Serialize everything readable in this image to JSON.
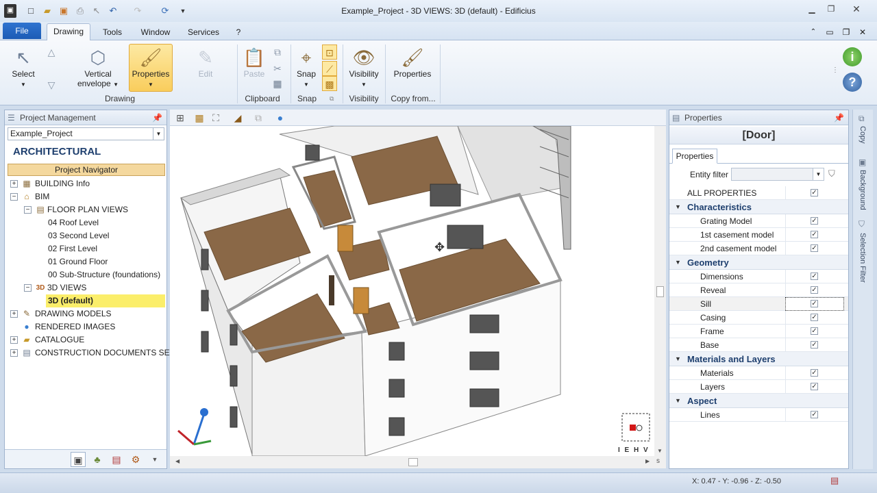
{
  "window": {
    "title": "Example_Project - 3D VIEWS: 3D (default) - Edificius"
  },
  "menu": {
    "file": "File",
    "tabs": [
      "Drawing",
      "Tools",
      "Window",
      "Services",
      "?"
    ]
  },
  "ribbon": {
    "select": "Select",
    "vertical": "Vertical",
    "envelope": "envelope",
    "properties": "Properties",
    "edit": "Edit",
    "drawing_group": "Drawing",
    "paste": "Paste",
    "clipboard_group": "Clipboard",
    "snap": "Snap",
    "snap_group": "Snap",
    "visibility": "Visibility",
    "visibility_group": "Visibility",
    "properties2": "Properties",
    "copy_group": "Copy from..."
  },
  "left": {
    "header": "Project Management",
    "project": "Example_Project",
    "section": "ARCHITECTURAL",
    "navigator": "Project Navigator",
    "tree": [
      "BUILDING Info",
      "BIM",
      "FLOOR PLAN VIEWS",
      "04 Roof Level",
      "03 Second Level",
      "02 First Level",
      "01 Ground Floor",
      "00 Sub-Structure (foundations)",
      "3D VIEWS",
      "3D (default)",
      "DRAWING MODELS",
      "RENDERED IMAGES",
      "CATALOGUE",
      "CONSTRUCTION DOCUMENTS SET"
    ]
  },
  "viewport": {
    "nav_cube": "I E H V"
  },
  "props": {
    "header": "Properties",
    "title": "[Door]",
    "tab": "Properties",
    "entity_filter": "Entity filter",
    "all": "ALL PROPERTIES",
    "cat_characteristics": "Characteristics",
    "grating": "Grating Model",
    "cas1": "1st casement model",
    "cas2": "2nd casement model",
    "cat_geometry": "Geometry",
    "dimensions": "Dimensions",
    "reveal": "Reveal",
    "sill": "Sill",
    "casing": "Casing",
    "frame": "Frame",
    "base": "Base",
    "cat_materials": "Materials and Layers",
    "materials": "Materials",
    "layers": "Layers",
    "cat_aspect": "Aspect",
    "lines": "Lines"
  },
  "side": {
    "copy": "Copy",
    "background": "Background",
    "selection": "Selection Filter"
  },
  "status": {
    "coords": "X: 0.47 - Y: -0.96 - Z: -0.50"
  },
  "colors": {
    "accent": "#1c5cb5",
    "selected": "#fbee6a",
    "navigator": "#f4d89e"
  }
}
